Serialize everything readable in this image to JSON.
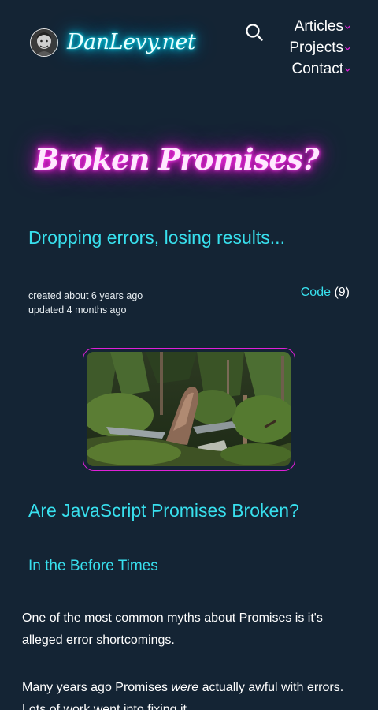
{
  "header": {
    "site_name": "DanLevy.net",
    "nav": [
      {
        "label": "Articles"
      },
      {
        "label": "Projects"
      },
      {
        "label": "Contact"
      }
    ]
  },
  "article": {
    "title": "Broken Promises?",
    "subtitle": "Dropping errors, losing results...",
    "created": "created about 6 years ago",
    "updated": "updated 4 months ago",
    "tag": {
      "label": "Code",
      "count": "(9)"
    },
    "heading": "Are JavaScript Promises Broken?",
    "section": "In the Before Times",
    "paragraph1": "One of the most common myths about Promises is it's alleged error shortcomings.",
    "paragraph2": {
      "before": "Many years ago Promises",
      "emphasis": "were",
      "after": "actually awful with errors. Lots of work went into fixing it."
    }
  },
  "colors": {
    "background": "#142434",
    "accent_cyan": "#38e0ee",
    "accent_magenta": "#e020d8"
  }
}
